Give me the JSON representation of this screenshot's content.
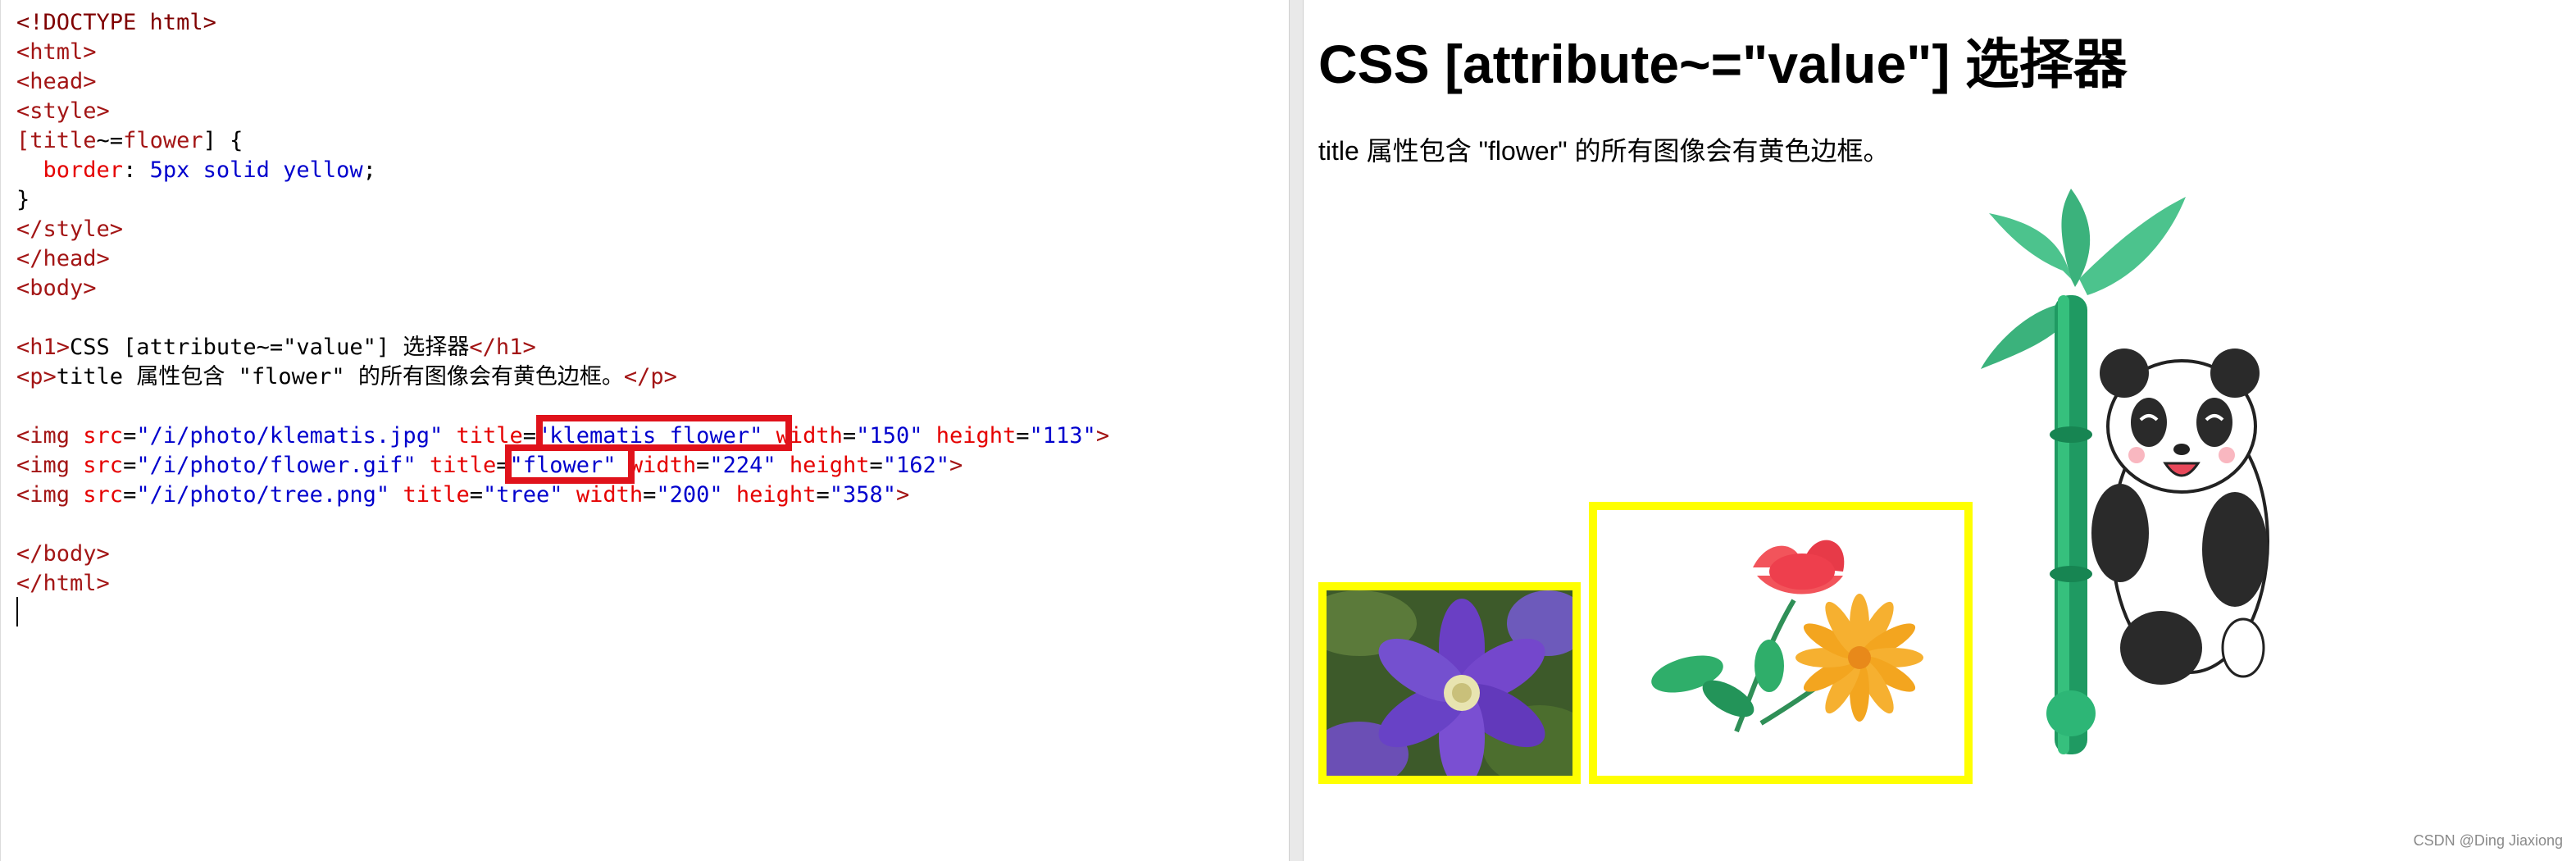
{
  "editor": {
    "lines": [
      [
        {
          "t": "<!DOCTYPE html>",
          "c": "brk"
        }
      ],
      [
        {
          "t": "<html>",
          "c": "tag"
        }
      ],
      [
        {
          "t": "<head>",
          "c": "tag"
        }
      ],
      [
        {
          "t": "<style>",
          "c": "tag"
        }
      ],
      [
        {
          "t": "[",
          "c": "tag"
        },
        {
          "t": "title",
          "c": "tag"
        },
        {
          "t": "~=",
          "c": "pun"
        },
        {
          "t": "flower",
          "c": "tag"
        },
        {
          "t": "] {",
          "c": "pun"
        }
      ],
      [
        {
          "t": "  ",
          "c": "txt"
        },
        {
          "t": "border",
          "c": "attr"
        },
        {
          "t": ": ",
          "c": "pun"
        },
        {
          "t": "5px solid yellow",
          "c": "val"
        },
        {
          "t": ";",
          "c": "pun"
        }
      ],
      [
        {
          "t": "}",
          "c": "pun"
        }
      ],
      [
        {
          "t": "</style>",
          "c": "tag"
        }
      ],
      [
        {
          "t": "</head>",
          "c": "tag"
        }
      ],
      [
        {
          "t": "<body>",
          "c": "tag"
        }
      ],
      [
        {
          "t": "",
          "c": "txt"
        }
      ],
      [
        {
          "t": "<h1>",
          "c": "tag"
        },
        {
          "t": "CSS [attribute~=\"value\"] 选择器",
          "c": "txt"
        },
        {
          "t": "</h1>",
          "c": "tag"
        }
      ],
      [
        {
          "t": "<p>",
          "c": "tag"
        },
        {
          "t": "title 属性包含 \"flower\" 的所有图像会有黄色边框。",
          "c": "txt"
        },
        {
          "t": "</p>",
          "c": "tag"
        }
      ],
      [
        {
          "t": "",
          "c": "txt"
        }
      ],
      [
        {
          "t": "<img ",
          "c": "tag"
        },
        {
          "t": "src",
          "c": "attr"
        },
        {
          "t": "=",
          "c": "pun"
        },
        {
          "t": "\"/i/photo/klematis.jpg\"",
          "c": "val"
        },
        {
          "t": " ",
          "c": "txt"
        },
        {
          "t": "title",
          "c": "attr"
        },
        {
          "t": "=",
          "c": "pun"
        },
        {
          "t": "\"klematis flower\"",
          "c": "val"
        },
        {
          "t": " ",
          "c": "txt"
        },
        {
          "t": "width",
          "c": "attr"
        },
        {
          "t": "=",
          "c": "pun"
        },
        {
          "t": "\"150\"",
          "c": "val"
        },
        {
          "t": " ",
          "c": "txt"
        },
        {
          "t": "height",
          "c": "attr"
        },
        {
          "t": "=",
          "c": "pun"
        },
        {
          "t": "\"113\"",
          "c": "val"
        },
        {
          "t": ">",
          "c": "tag"
        }
      ],
      [
        {
          "t": "<img ",
          "c": "tag"
        },
        {
          "t": "src",
          "c": "attr"
        },
        {
          "t": "=",
          "c": "pun"
        },
        {
          "t": "\"/i/photo/flower.gif\"",
          "c": "val"
        },
        {
          "t": " ",
          "c": "txt"
        },
        {
          "t": "title",
          "c": "attr"
        },
        {
          "t": "=",
          "c": "pun"
        },
        {
          "t": "\"flower\"",
          "c": "val"
        },
        {
          "t": " ",
          "c": "txt"
        },
        {
          "t": "width",
          "c": "attr"
        },
        {
          "t": "=",
          "c": "pun"
        },
        {
          "t": "\"224\"",
          "c": "val"
        },
        {
          "t": " ",
          "c": "txt"
        },
        {
          "t": "height",
          "c": "attr"
        },
        {
          "t": "=",
          "c": "pun"
        },
        {
          "t": "\"162\"",
          "c": "val"
        },
        {
          "t": ">",
          "c": "tag"
        }
      ],
      [
        {
          "t": "<img ",
          "c": "tag"
        },
        {
          "t": "src",
          "c": "attr"
        },
        {
          "t": "=",
          "c": "pun"
        },
        {
          "t": "\"/i/photo/tree.png\"",
          "c": "val"
        },
        {
          "t": " ",
          "c": "txt"
        },
        {
          "t": "title",
          "c": "attr"
        },
        {
          "t": "=",
          "c": "pun"
        },
        {
          "t": "\"tree\"",
          "c": "val"
        },
        {
          "t": " ",
          "c": "txt"
        },
        {
          "t": "width",
          "c": "attr"
        },
        {
          "t": "=",
          "c": "pun"
        },
        {
          "t": "\"200\"",
          "c": "val"
        },
        {
          "t": " ",
          "c": "txt"
        },
        {
          "t": "height",
          "c": "attr"
        },
        {
          "t": "=",
          "c": "pun"
        },
        {
          "t": "\"358\"",
          "c": "val"
        },
        {
          "t": ">",
          "c": "tag"
        }
      ],
      [
        {
          "t": "",
          "c": "txt"
        }
      ],
      [
        {
          "t": "</body>",
          "c": "tag"
        }
      ],
      [
        {
          "t": "</html>",
          "c": "tag"
        }
      ]
    ]
  },
  "preview": {
    "heading": "CSS [attribute~=\"value\"] 选择器",
    "paragraph": "title 属性包含 \"flower\" 的所有图像会有黄色边框。",
    "watermark": "CSDN @Ding Jiaxiong",
    "images": [
      {
        "title": "klematis flower",
        "bordered": true
      },
      {
        "title": "flower",
        "bordered": true
      },
      {
        "title": "tree",
        "bordered": false
      }
    ]
  },
  "colors": {
    "highlight": "#e0121b",
    "border_yellow": "#ffff00",
    "tag": "#a31515",
    "attribute": "#e50000",
    "value": "#0000cd"
  }
}
